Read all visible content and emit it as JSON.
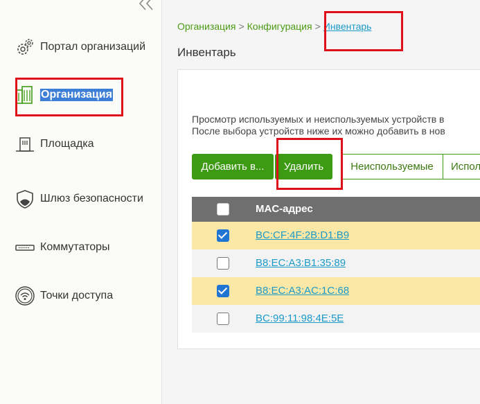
{
  "sidebar": {
    "items": [
      {
        "label": "Портал организаций",
        "icon": "gear-icon"
      },
      {
        "label": "Организация",
        "icon": "buildings-icon",
        "active": true
      },
      {
        "label": "Площадка",
        "icon": "site-icon"
      },
      {
        "label": "Шлюз безопасности",
        "icon": "shield-icon"
      },
      {
        "label": "Коммутаторы",
        "icon": "switch-icon"
      },
      {
        "label": "Точки доступа",
        "icon": "wifi-ap-icon"
      }
    ]
  },
  "breadcrumb": {
    "level1": "Организация",
    "sep": ">",
    "level2": "Конфигурация",
    "current": "Инвентарь"
  },
  "page": {
    "title": "Инвентарь",
    "description_line1": "Просмотр используемых и неиспользуемых устройств в",
    "description_line2": "После выбора устройств ниже их можно добавить в нов"
  },
  "toolbar": {
    "add_label": "Добавить в...",
    "delete_label": "Удалить",
    "unused_label": "Неиспользуемые",
    "used_label": "Испол"
  },
  "table": {
    "header_mac": "MAC-адрес",
    "rows": [
      {
        "mac": "BC:CF:4F:2B:D1:B9",
        "checked": true
      },
      {
        "mac": "B8:EC:A3:B1:35:89",
        "checked": false
      },
      {
        "mac": "B8:EC:A3:AC:1C:68",
        "checked": true
      },
      {
        "mac": "BC:99:11:98:4E:5E",
        "checked": false
      }
    ]
  },
  "colors": {
    "green": "#3c9b12",
    "highlight_row": "#fbe7a6",
    "link": "#1a9ac9",
    "annotation_red": "#e0101a"
  }
}
